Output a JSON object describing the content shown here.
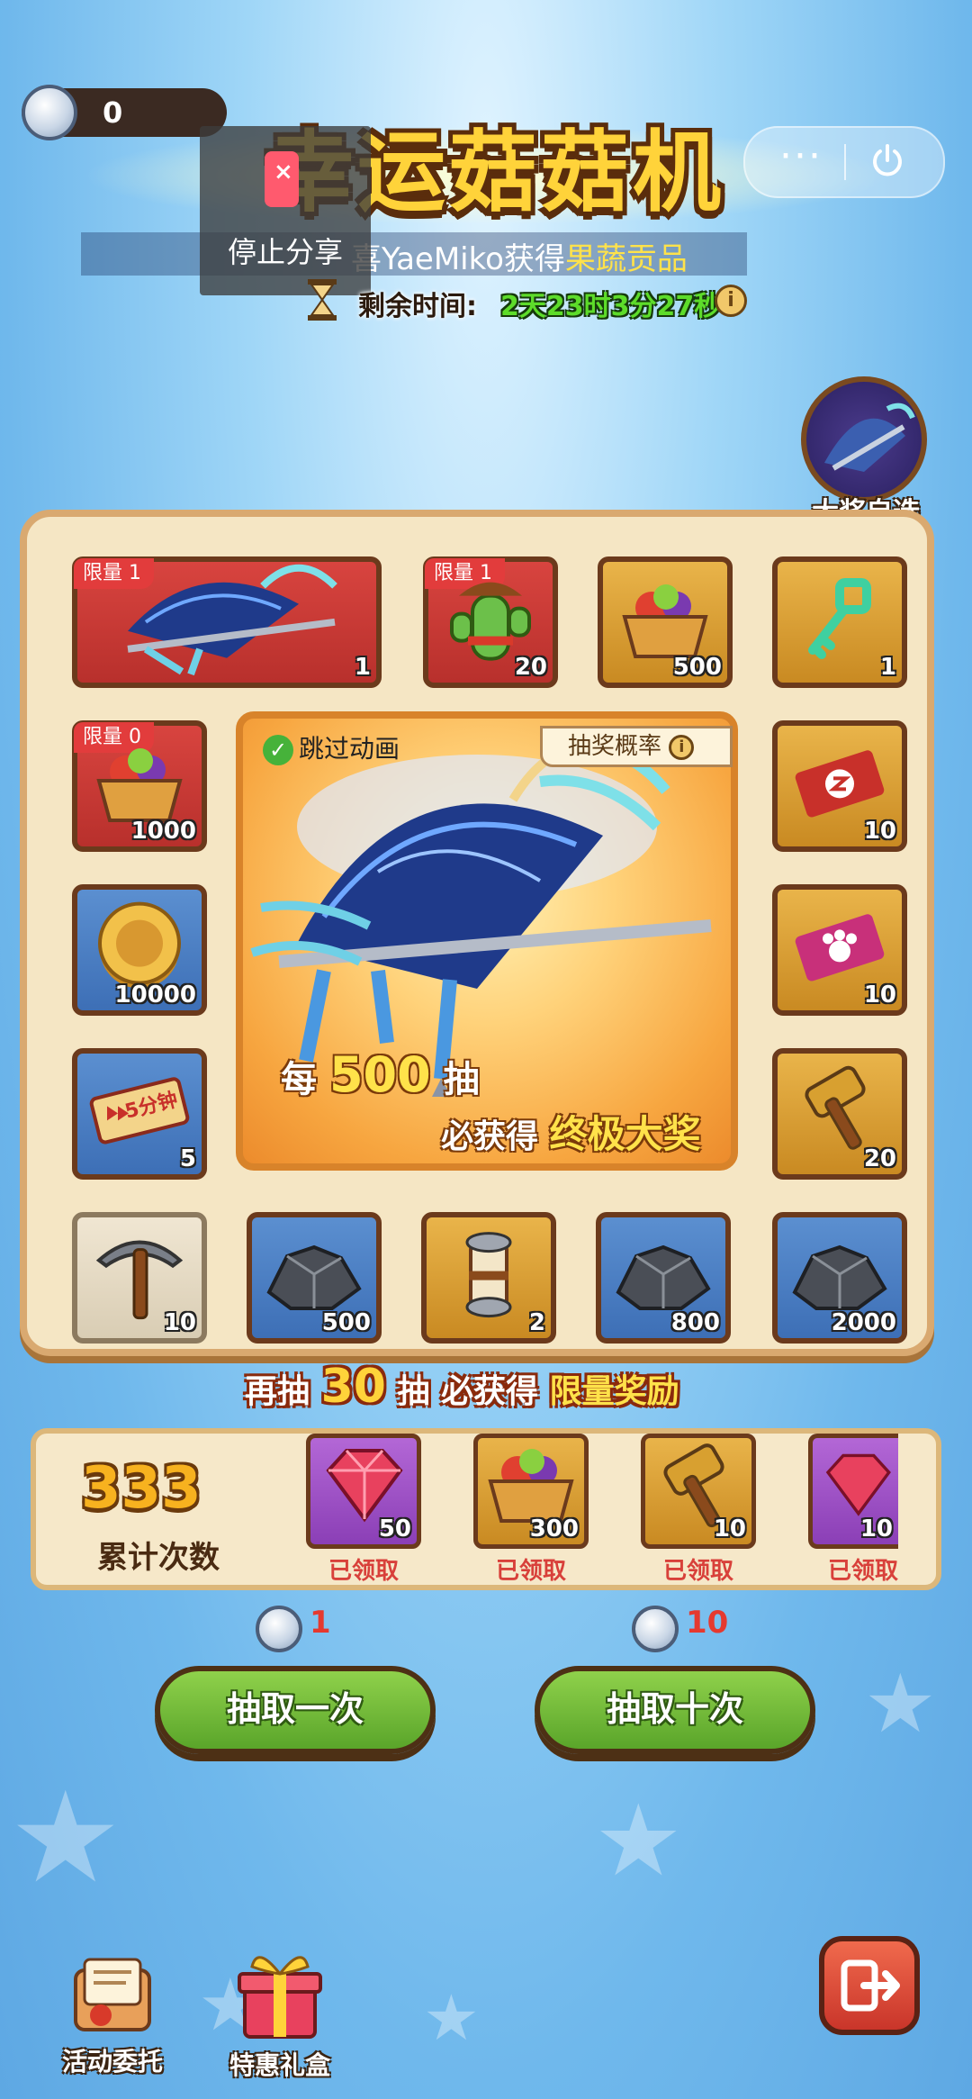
{
  "header": {
    "coin_balance": "0",
    "title": "幸运菇菇机",
    "capsule_menu": "···",
    "share_label": "停止分享",
    "ticker_text_prefix": "喜YaeMiko获得",
    "ticker_text_item": "果蔬贡品",
    "timer_label": "剩余时间:",
    "timer_value": "2天23时3分27秒",
    "info_glyph": "i"
  },
  "grand_prize": {
    "label": "大奖自选"
  },
  "board": {
    "skip_animation": "跳过动画",
    "odds": "抽奖概率",
    "every_prefix": "每",
    "every_num": "500",
    "every_suffix": "抽",
    "guarantee_prefix": "必获得",
    "guarantee_prize": "终极大奖",
    "tiles": [
      {
        "name": "fan",
        "color": "red",
        "limit": "限量 1",
        "qty": "1"
      },
      {
        "name": "cactus",
        "color": "red",
        "limit": "限量 1",
        "qty": "20"
      },
      {
        "name": "basket",
        "color": "gold",
        "qty": "500"
      },
      {
        "name": "key",
        "color": "gold",
        "qty": "1"
      },
      {
        "name": "basket",
        "color": "red",
        "limit": "限量 0",
        "qty": "1000"
      },
      {
        "name": "ticket-red",
        "color": "gold",
        "qty": "10"
      },
      {
        "name": "coin",
        "color": "blue",
        "qty": "10000"
      },
      {
        "name": "ticket-pink",
        "color": "gold",
        "qty": "10"
      },
      {
        "name": "speedup",
        "color": "blue",
        "qty": "5",
        "speed_label": "5分钟"
      },
      {
        "name": "hammer",
        "color": "gold",
        "qty": "20"
      },
      {
        "name": "pickaxe",
        "color": "gray",
        "qty": "10"
      },
      {
        "name": "ore",
        "color": "blue",
        "qty": "500"
      },
      {
        "name": "scroll",
        "color": "gold",
        "qty": "2"
      },
      {
        "name": "ore",
        "color": "blue",
        "qty": "800"
      },
      {
        "name": "ore",
        "color": "blue",
        "qty": "2000"
      }
    ]
  },
  "pity": {
    "prefix": "再抽",
    "num": "30",
    "mid": "抽 必获得",
    "reward": "限量奖励"
  },
  "progress": {
    "count": "333",
    "count_label": "累计次数",
    "rewards": [
      {
        "icon": "gem",
        "color": "purple",
        "qty": "50",
        "status": "已领取"
      },
      {
        "icon": "basket",
        "color": "gold",
        "qty": "300",
        "status": "已领取"
      },
      {
        "icon": "hammer",
        "color": "gold",
        "qty": "10",
        "status": "已领取"
      },
      {
        "icon": "gem",
        "color": "purple",
        "qty": "10",
        "status": "已领取"
      }
    ]
  },
  "draw": {
    "single_cost": "1",
    "ten_cost": "10",
    "single_label": "抽取一次",
    "ten_label": "抽取十次"
  },
  "bottom": {
    "commission_label": "活动委托",
    "gift_label": "特惠礼盒"
  }
}
